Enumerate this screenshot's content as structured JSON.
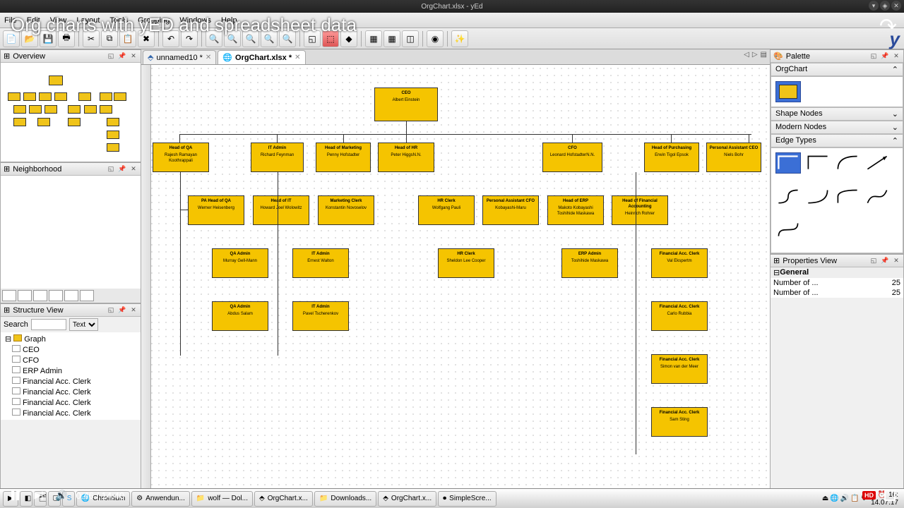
{
  "video": {
    "title": "Org charts with yED and spreadsheet data",
    "current_time": "0:46",
    "duration": "14:40",
    "hd": "HD"
  },
  "window": {
    "title": "OrgChart.xlsx - yEd"
  },
  "menu": [
    "File",
    "Edit",
    "View",
    "Layout",
    "Tools",
    "Grouping",
    "Windows",
    "Help"
  ],
  "tabs": {
    "t1": "unnamed10 *",
    "t2": "OrgChart.xlsx *"
  },
  "panels": {
    "overview": "Overview",
    "neighborhood": "Neighborhood",
    "structure": "Structure View",
    "palette": "Palette",
    "props": "Properties View"
  },
  "structure": {
    "search_label": "Search",
    "mode": "Text",
    "root": "Graph",
    "nodes": [
      "CEO",
      "CFO",
      "ERP Admin",
      "Financial Acc. Clerk",
      "Financial Acc. Clerk",
      "Financial Acc. Clerk",
      "Financial Acc. Clerk"
    ]
  },
  "palette": {
    "sections": {
      "orgchart": "OrgChart",
      "shape": "Shape Nodes",
      "modern": "Modern Nodes",
      "edge": "Edge Types"
    }
  },
  "props": {
    "general": "General",
    "r1k": "Number of ...",
    "r1v": "25",
    "r2k": "Number of ...",
    "r2v": "25"
  },
  "org": {
    "ceo": {
      "t": "CEO",
      "n": "Albert Einstein"
    },
    "qa": {
      "t": "Head of QA",
      "n": "Rajesh Ramayan Koothrappali"
    },
    "itadmin": {
      "t": "IT Admin",
      "n": "Richard Feynman"
    },
    "mkt": {
      "t": "Head of Marketing",
      "n": "Penny Hofstadter"
    },
    "hr": {
      "t": "Head of HR",
      "n": "Peter Higgs",
      "n2": "N.N."
    },
    "cfo": {
      "t": "CFO",
      "n": "Leonard Hofstadter",
      "n2": "N.N."
    },
    "purch": {
      "t": "Head of Purchasing",
      "n": "Erwin Tigol Epsok"
    },
    "paceo": {
      "t": "Personal Assistant CEO",
      "n": "Niels Bohr"
    },
    "paqa": {
      "t": "PA Head of QA",
      "n": "Werner Heisenberg"
    },
    "hit": {
      "t": "Head of IT",
      "n": "Howard Joel Wolowitz"
    },
    "mktc": {
      "t": "Marketing Clerk",
      "n": "Konstantin Novoselov"
    },
    "hrc": {
      "t": "HR Clerk",
      "n": "Wolfgang Pauli"
    },
    "pacfo": {
      "t": "Personal Assistant CFO",
      "n": "Kobayashi-Maru"
    },
    "herp": {
      "t": "Head of ERP",
      "n": "Makoto Kobayashi Toshihide Maskawa"
    },
    "hfa": {
      "t": "Head of Financial Accounting",
      "n": "Heinrich Rohrer"
    },
    "qaa1": {
      "t": "QA Admin",
      "n": "Murray Gell-Mann"
    },
    "ita2": {
      "t": "IT Admin",
      "n": "Ernest Walton"
    },
    "hrc2": {
      "t": "HR Clerk",
      "n": "Sheldon Lee Cooper"
    },
    "erpa": {
      "t": "ERP Admin",
      "n": "Toshihide Maskawa"
    },
    "fac1": {
      "t": "Financial Acc. Clerk",
      "n": "Val Ekspertm"
    },
    "qaa2": {
      "t": "QA Admin",
      "n": "Abdus Salam"
    },
    "ita3": {
      "t": "IT Admin",
      "n": "Pavel Tscherenkov"
    },
    "fac2": {
      "t": "Financial Acc. Clerk",
      "n": "Carlo Rubbia"
    },
    "fac3": {
      "t": "Financial Acc. Clerk",
      "n": "Simon van der Meer"
    },
    "fac4": {
      "t": "Financial Acc. Clerk",
      "n": "Sam Sting"
    }
  },
  "taskbar": {
    "items": [
      "Chromium",
      "Anwendun...",
      "wolf — Dol...",
      "OrgChart.x...",
      "Downloads...",
      "OrgChart.x...",
      "SimpleScre..."
    ],
    "clock_time": "16:",
    "clock_date": "14.07.17"
  }
}
